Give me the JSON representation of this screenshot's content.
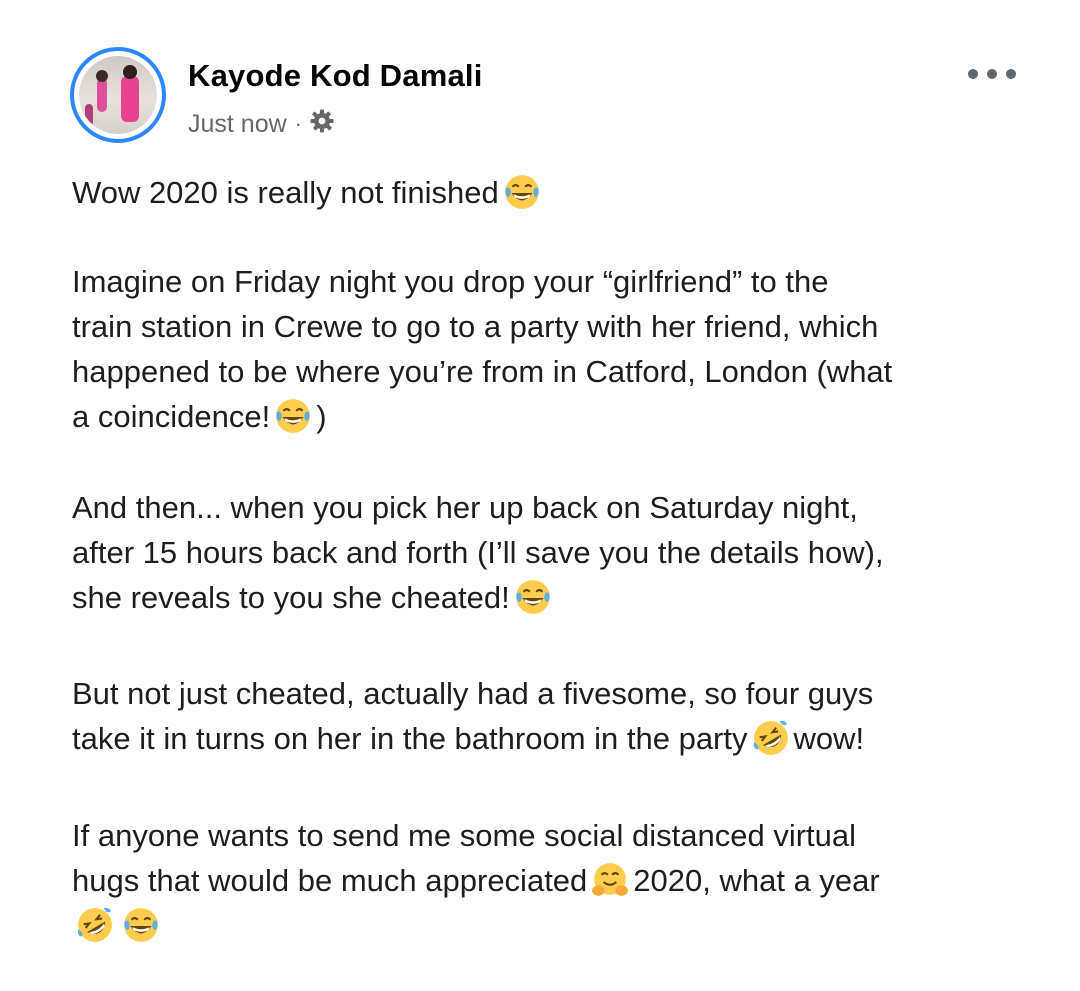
{
  "post": {
    "author": "Kayode Kod Damali",
    "timestamp": "Just now",
    "separator": "·",
    "privacy_icon": "gear-icon",
    "menu_icon": "more-options-icon",
    "paragraphs": [
      {
        "lines": [
          {
            "text": "Wow 2020 is really not finished",
            "emoji_after": [
              "tears-of-joy"
            ]
          }
        ]
      },
      {
        "lines": [
          {
            "text": "Imagine on Friday night you drop your “girlfriend” to the"
          },
          {
            "text": "train station in Crewe to go to a party with her friend, which"
          },
          {
            "text": "happened to be where you’re from in Catford, London (what"
          },
          {
            "text": "a coincidence!",
            "emoji_after": [
              "tears-of-joy"
            ],
            "tail": ")"
          }
        ]
      },
      {
        "lines": [
          {
            "text": "And then... when you pick her up back on Saturday night,"
          },
          {
            "text": "after 15 hours back and forth (I’ll save you the details how),"
          },
          {
            "text": "she reveals to you she cheated!",
            "emoji_after": [
              "tears-of-joy"
            ]
          }
        ]
      },
      {
        "lines": [
          {
            "text": "But not just cheated, actually had a fivesome, so four guys"
          },
          {
            "text": "take it in turns on her in the bathroom in the party",
            "emoji_after": [
              "rofl"
            ],
            "tail": "wow!"
          }
        ]
      },
      {
        "lines": [
          {
            "text": "If anyone wants to send me some social distanced virtual"
          },
          {
            "text": "hugs that would be much appreciated",
            "emoji_after": [
              "hugging"
            ],
            "tail": "2020, what a year"
          },
          {
            "text": "",
            "emoji_after": [
              "rofl",
              "tears-of-joy"
            ]
          }
        ]
      }
    ]
  },
  "colors": {
    "avatar_ring": "#2d88ff",
    "text": "#1c1e21",
    "meta": "#65676b",
    "emoji_face": "#ffcc4d",
    "emoji_tear": "#5dadec"
  }
}
